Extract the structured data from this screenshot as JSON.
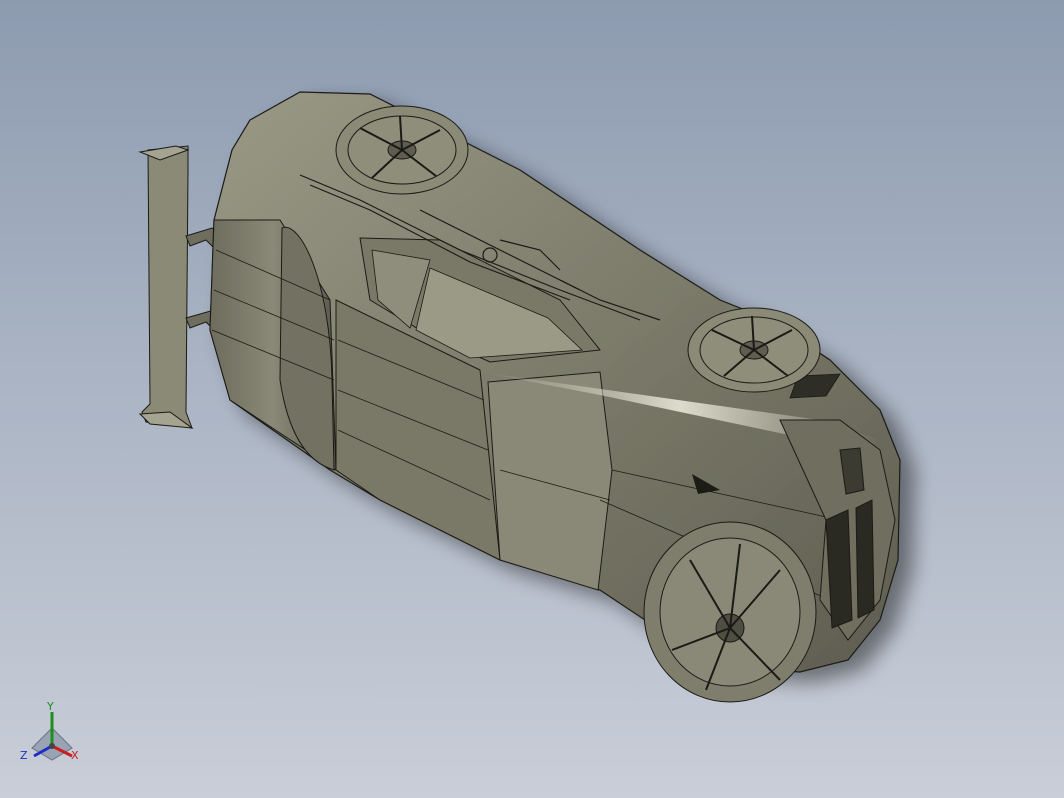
{
  "viewport": {
    "background_top": "#8d9bb0",
    "background_bottom": "#c9ced8",
    "model_color": "#7c7b6a",
    "edge_color": "#1a1a16"
  },
  "model": {
    "parts": [
      "car-body",
      "rear-spoiler",
      "wheel-rear-left",
      "wheel-front-left",
      "wheel-front-right",
      "windshield",
      "grille",
      "hood-decal"
    ]
  },
  "triad": {
    "axes": {
      "x": {
        "label": "X",
        "color": "#c81e1e"
      },
      "y": {
        "label": "Y",
        "color": "#1d8f1d"
      },
      "z": {
        "label": "Z",
        "color": "#1e2fc8"
      }
    }
  }
}
